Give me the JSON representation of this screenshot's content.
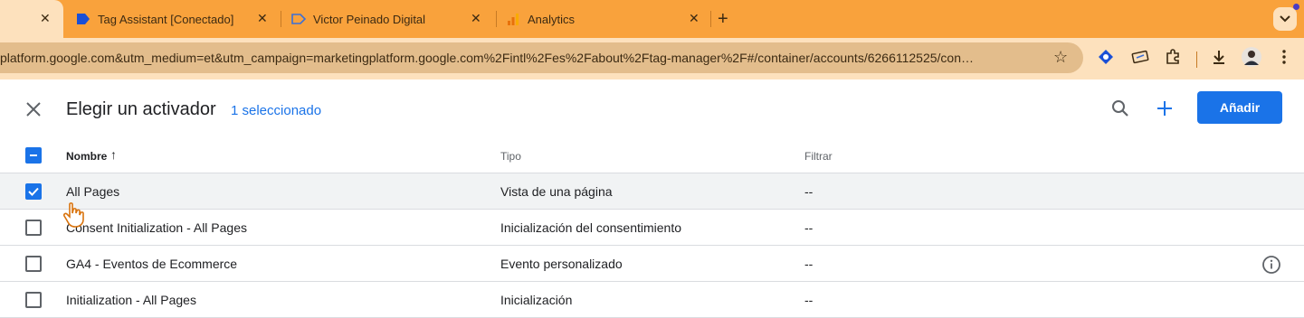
{
  "browser": {
    "tabs": [
      {
        "label": "",
        "close": "✕",
        "icon": "blank-page-icon"
      },
      {
        "label": "Tag Assistant [Conectado]",
        "close": "✕",
        "icon": "tag-assistant-icon"
      },
      {
        "label": "Victor Peinado Digital",
        "close": "✕",
        "icon": "tag-outline-icon"
      },
      {
        "label": "Analytics",
        "close": "✕",
        "icon": "analytics-icon"
      }
    ],
    "new_tab": "+",
    "url": "platform.google.com&utm_medium=et&utm_campaign=marketingplatform.google.com%2Fintl%2Fes%2Fabout%2Ftag-manager%2F#/container/accounts/6266112525/con…"
  },
  "dialog": {
    "title": "Elegir un activador",
    "selected_count": "1 seleccionado",
    "add_button": "Añadir",
    "columns": {
      "name": "Nombre",
      "type": "Tipo",
      "filter": "Filtrar"
    },
    "sort_indicator": "↑",
    "rows": [
      {
        "name": "All Pages",
        "type": "Vista de una página",
        "filter": "--",
        "checked": true
      },
      {
        "name": "Consent Initialization - All Pages",
        "type": "Inicialización del consentimiento",
        "filter": "--",
        "checked": false
      },
      {
        "name": "GA4 - Eventos de Ecommerce",
        "type": "Evento personalizado",
        "filter": "--",
        "checked": false
      },
      {
        "name": "Initialization - All Pages",
        "type": "Inicialización",
        "filter": "--",
        "checked": false
      }
    ]
  },
  "colors": {
    "accent": "#1a73e8",
    "tabbar": "#f9a23c",
    "toolbar": "#fde1bd"
  }
}
